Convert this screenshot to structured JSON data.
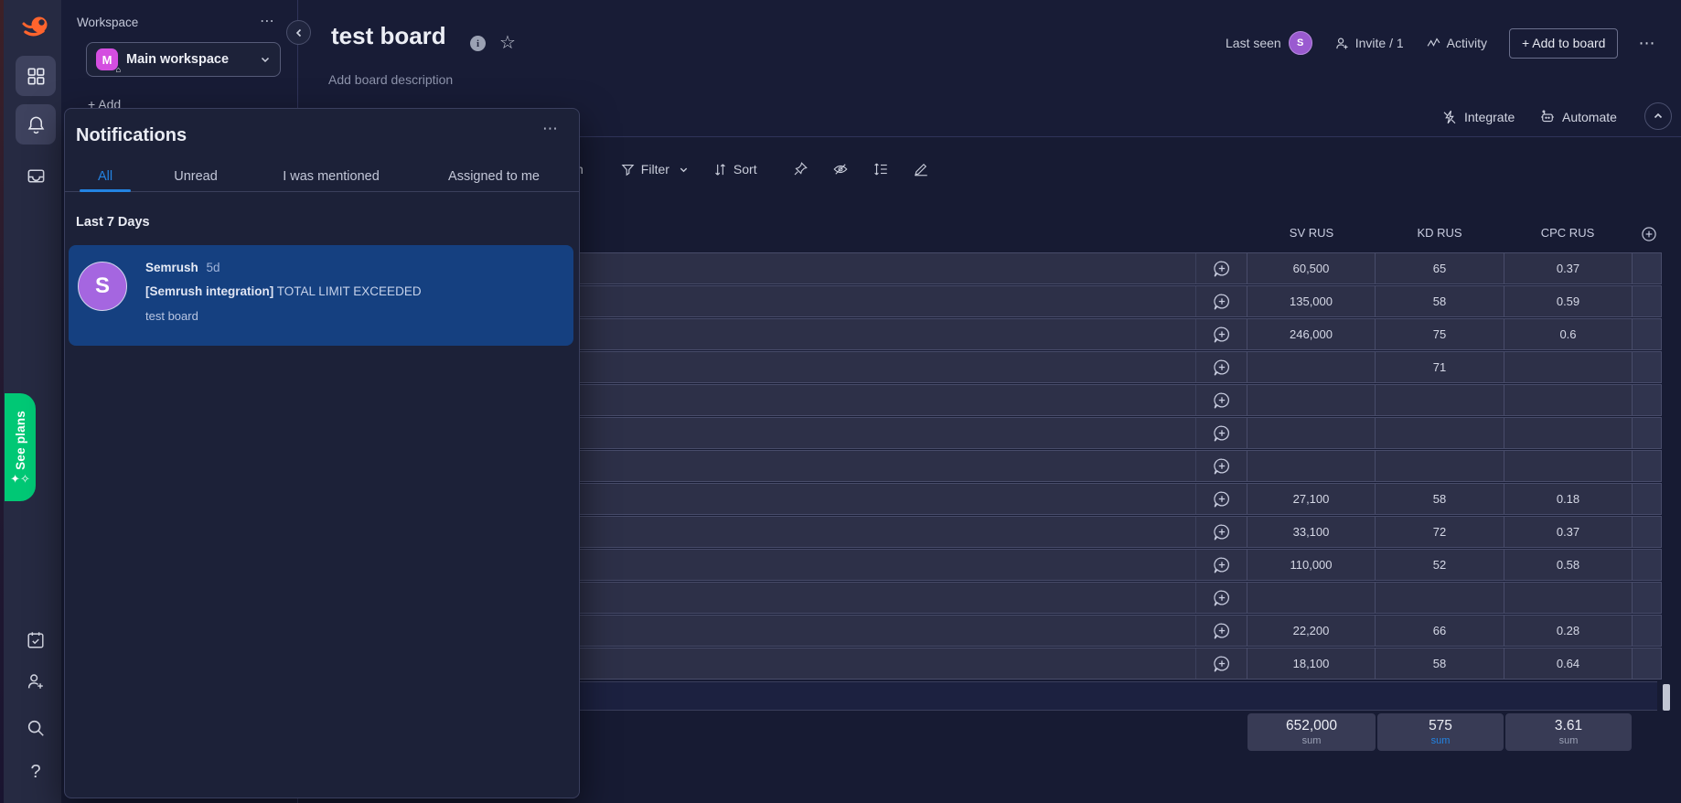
{
  "workspace": {
    "label": "Workspace",
    "name": "Main workspace",
    "avatar_letter": "M",
    "add_partial": "+ Add"
  },
  "board": {
    "title": "test board",
    "description_placeholder": "Add board description",
    "last_seen_label": "Last seen",
    "member_avatar_letter": "S",
    "invite_label": "Invite / 1",
    "activity_label": "Activity",
    "add_to_board_label": "+ Add to board"
  },
  "actions": {
    "integrate_label": "Integrate",
    "automate_label": "Automate"
  },
  "toolbar": {
    "clipped_text": "n",
    "filter_label": "Filter",
    "sort_label": "Sort"
  },
  "sidebar": {
    "see_plans_label": "See plans"
  },
  "notifications": {
    "title": "Notifications",
    "tabs": [
      "All",
      "Unread",
      "I was mentioned",
      "Assigned to me"
    ],
    "active_tab": "All",
    "section_header": "Last 7 Days",
    "item": {
      "avatar_letter": "S",
      "sender": "Semrush",
      "time": "5d",
      "subject_prefix": "[Semrush integration]",
      "subject": "TOTAL LIMIT EXCEEDED",
      "board": "test board"
    }
  },
  "table": {
    "columns": [
      "SV RUS",
      "KD RUS",
      "CPC RUS"
    ],
    "rows": [
      [
        "60,500",
        "65",
        "0.37"
      ],
      [
        "135,000",
        "58",
        "0.59"
      ],
      [
        "246,000",
        "75",
        "0.6"
      ],
      [
        "",
        "71",
        ""
      ],
      [
        "",
        "",
        ""
      ],
      [
        "",
        "",
        ""
      ],
      [
        "",
        "",
        ""
      ],
      [
        "27,100",
        "58",
        "0.18"
      ],
      [
        "33,100",
        "72",
        "0.37"
      ],
      [
        "110,000",
        "52",
        "0.58"
      ],
      [
        "",
        "",
        ""
      ],
      [
        "22,200",
        "66",
        "0.28"
      ],
      [
        "18,100",
        "58",
        "0.64"
      ]
    ],
    "summary": {
      "values": [
        "652,000",
        "575",
        "3.61"
      ],
      "label": "sum",
      "highlighted_column": "KD RUS"
    }
  },
  "glyphs": {
    "more": "⋯",
    "star": "☆",
    "help": "?",
    "home": "⌂",
    "sparkles": "✦✧",
    "info": "i"
  },
  "colors": {
    "accent_blue": "#2383e2",
    "plans_green": "#00c875",
    "avatar_purple": "#a566e0",
    "workspace_magenta": "#d44ee0",
    "notification_card_blue": "#154080",
    "logo_orange": "#ff642d"
  }
}
